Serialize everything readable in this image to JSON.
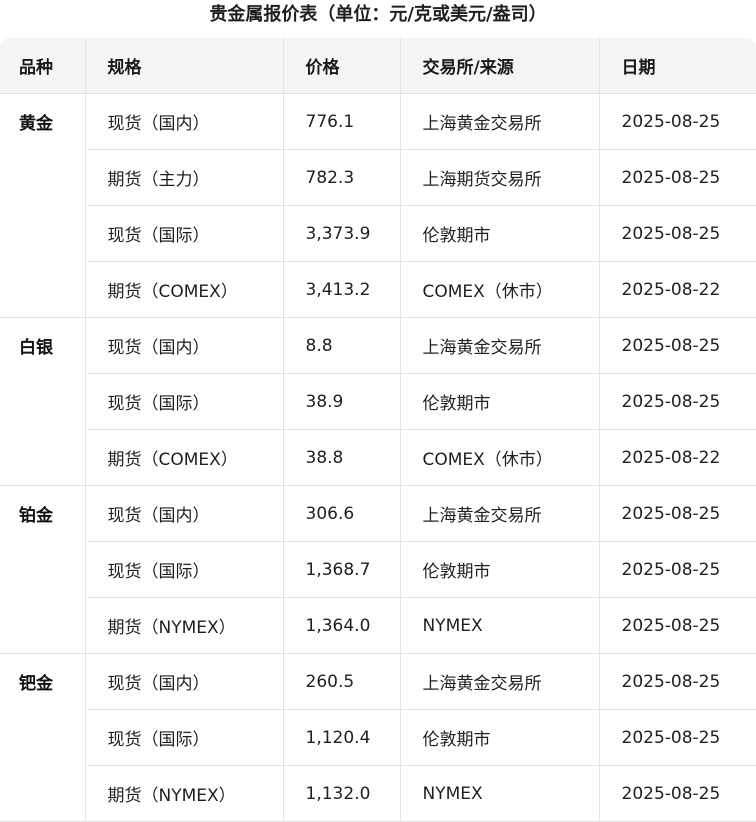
{
  "caption": "贵金属报价表（单位：元/克或美元/盎司）",
  "headers": [
    "品种",
    "规格",
    "价格",
    "交易所/来源",
    "日期"
  ],
  "rows": [
    {
      "kind": "黄金",
      "spec": "现货（国内）",
      "price": "776.1",
      "source": "上海黄金交易所",
      "date": "2025-08-25"
    },
    {
      "kind": "",
      "spec": "期货（主力）",
      "price": "782.3",
      "source": "上海期货交易所",
      "date": "2025-08-25"
    },
    {
      "kind": "",
      "spec": "现货（国际）",
      "price": "3,373.9",
      "source": "伦敦期市",
      "date": "2025-08-25"
    },
    {
      "kind": "",
      "spec": "期货（COMEX）",
      "price": "3,413.2",
      "source": "COMEX（休市）",
      "date": "2025-08-22"
    },
    {
      "kind": "白银",
      "spec": "现货（国内）",
      "price": "8.8",
      "source": "上海黄金交易所",
      "date": "2025-08-25"
    },
    {
      "kind": "",
      "spec": "现货（国际）",
      "price": "38.9",
      "source": "伦敦期市",
      "date": "2025-08-25"
    },
    {
      "kind": "",
      "spec": "期货（COMEX）",
      "price": "38.8",
      "source": "COMEX（休市）",
      "date": "2025-08-22"
    },
    {
      "kind": "铂金",
      "spec": "现货（国内）",
      "price": "306.6",
      "source": "上海黄金交易所",
      "date": "2025-08-25"
    },
    {
      "kind": "",
      "spec": "现货（国际）",
      "price": "1,368.7",
      "source": "伦敦期市",
      "date": "2025-08-25"
    },
    {
      "kind": "",
      "spec": "期货（NYMEX）",
      "price": "1,364.0",
      "source": "NYMEX",
      "date": "2025-08-25"
    },
    {
      "kind": "钯金",
      "spec": "现货（国内）",
      "price": "260.5",
      "source": "上海黄金交易所",
      "date": "2025-08-25"
    },
    {
      "kind": "",
      "spec": "现货（国际）",
      "price": "1,120.4",
      "source": "伦敦期市",
      "date": "2025-08-25"
    },
    {
      "kind": "",
      "spec": "期货（NYMEX）",
      "price": "1,132.0",
      "source": "NYMEX",
      "date": "2025-08-25"
    }
  ]
}
